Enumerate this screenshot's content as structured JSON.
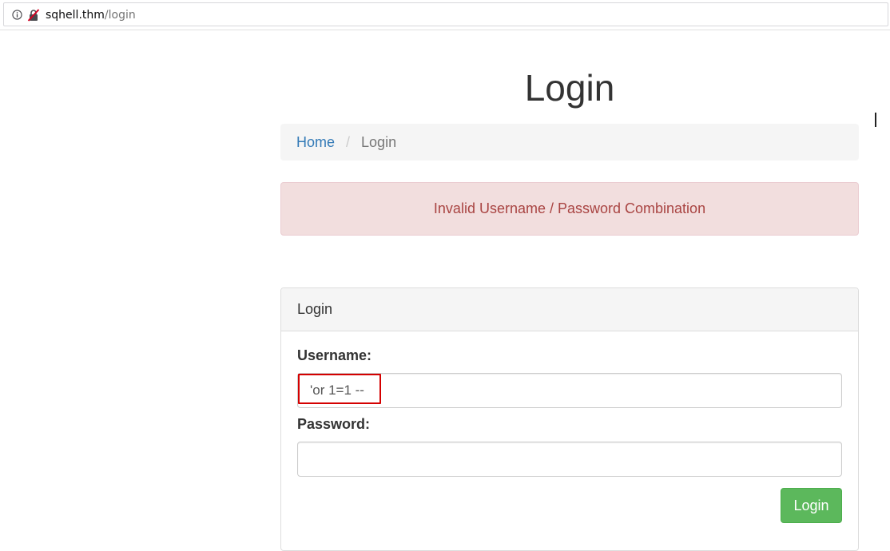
{
  "browser": {
    "url_domain": "sqhell.thm",
    "url_path": "/login"
  },
  "page": {
    "title": "Login"
  },
  "breadcrumb": {
    "home": "Home",
    "separator": "/",
    "current": "Login"
  },
  "alert": {
    "message": "Invalid Username / Password Combination"
  },
  "login_panel": {
    "heading": "Login",
    "username_label": "Username:",
    "username_value": "'or 1=1 --",
    "password_label": "Password:",
    "password_value": "",
    "submit_label": "Login"
  },
  "colors": {
    "link": "#337ab7",
    "alert_bg": "#f2dede",
    "alert_text": "#a94442",
    "button": "#5cb85c",
    "highlight": "#d40000"
  }
}
